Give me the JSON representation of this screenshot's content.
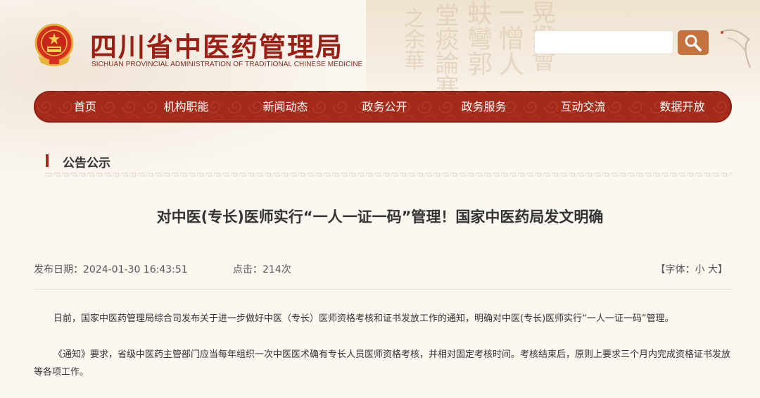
{
  "header": {
    "title": "四川省中医药管理局",
    "subtitle": "SICHUAN PROVINCIAL ADMINISTRATION OF TRADITIONAL CHINESE MEDICINE",
    "emblem_icon": "national-emblem-icon",
    "search": {
      "value": "",
      "placeholder": "",
      "button_icon": "search-icon"
    }
  },
  "nav": {
    "items": [
      {
        "label": "首页"
      },
      {
        "label": "机构职能"
      },
      {
        "label": "新闻动态"
      },
      {
        "label": "政务公开"
      },
      {
        "label": "政务服务"
      },
      {
        "label": "互动交流"
      },
      {
        "label": "数据开放"
      }
    ]
  },
  "section": {
    "title": "公告公示"
  },
  "article": {
    "title": "对中医(专长)医师实行“一人一证一码”管理！国家中医药局发文明确",
    "publish_date": "发布日期：2024-01-30 16:43:51",
    "clicks": "点击：214次",
    "font_size": {
      "open": "【",
      "label": "字体：",
      "small": "小",
      "large": "大",
      "close": "】"
    },
    "paragraphs": [
      "日前，国家中医药管理局综合司发布关于进一步做好中医（专长）医师资格考核和证书发放工作的通知，明确对中医(专长)医师实行“一人一证一码”管理。",
      "《通知》要求，省级中医药主管部门应当每年组织一次中医医术确有专长人员医师资格考核，并相对固定考核时间。考核结束后，原则上要求三个月内完成资格证书发放等各项工作。"
    ]
  },
  "colors": {
    "brand_red": "#a42a1a",
    "title_red": "#9a1f14",
    "search_button": "#c5723e",
    "background": "#fbf7f1"
  }
}
